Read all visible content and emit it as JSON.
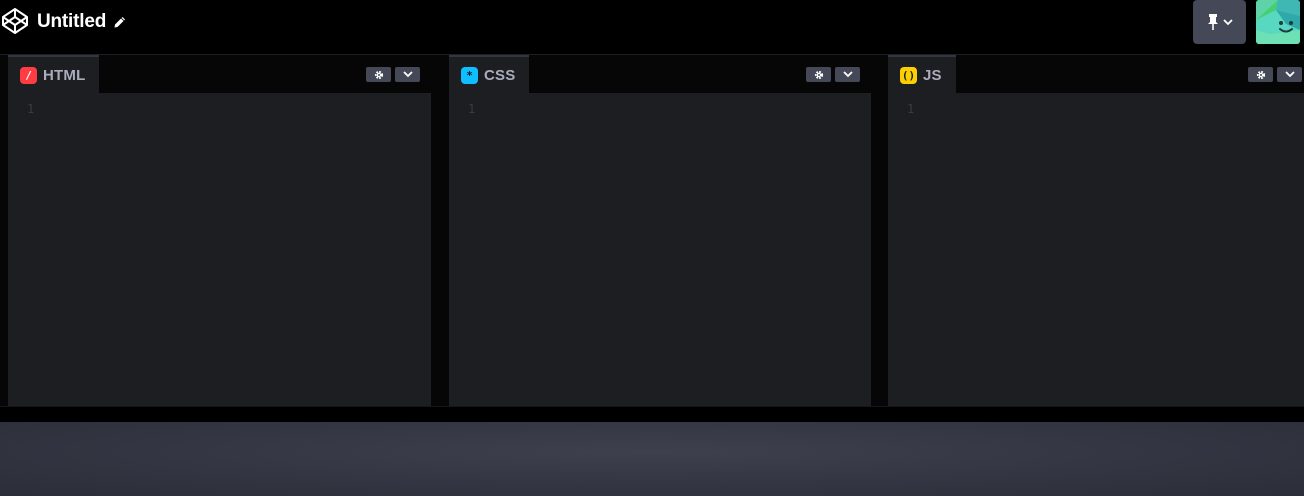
{
  "header": {
    "title": "Untitled",
    "logo_icon": "codepen-logo-icon",
    "edit_icon": "pencil-icon",
    "pin_icon": "pin-icon"
  },
  "editors": [
    {
      "label": "HTML",
      "badge_symbol": "/",
      "badge_color": "#ff3c41",
      "badge_text_color": "#ffffff",
      "line_number": "1"
    },
    {
      "label": "CSS",
      "badge_symbol": "*",
      "badge_color": "#0ebeff",
      "badge_text_color": "#0b1a2a",
      "line_number": "1"
    },
    {
      "label": "JS",
      "badge_symbol": "()",
      "badge_color": "#fcd000",
      "badge_text_color": "#1d1e22",
      "line_number": "1"
    }
  ],
  "colors": {
    "header_bg": "#000000",
    "editor_bg": "#1d1e22",
    "button_bg": "#444857",
    "tab_text": "#aaaebc"
  }
}
